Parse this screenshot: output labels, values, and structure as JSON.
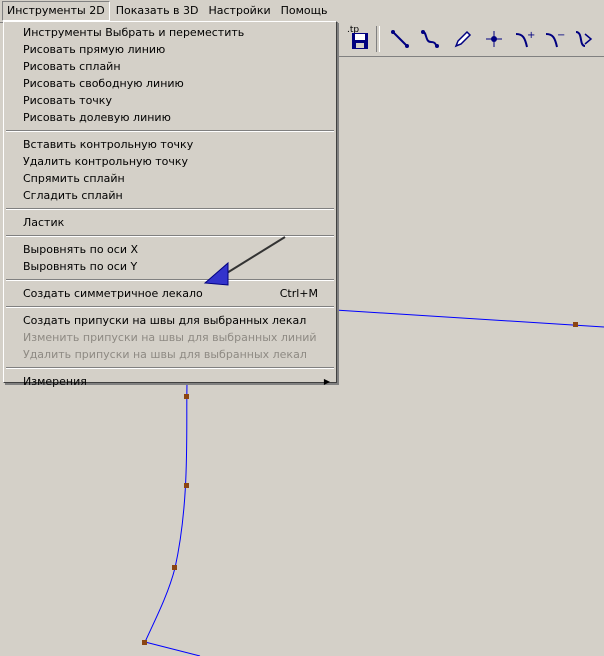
{
  "menubar": {
    "items": [
      {
        "label": "Инструменты 2D"
      },
      {
        "label": "Показать в 3D"
      },
      {
        "label": "Настройки"
      },
      {
        "label": "Помощь"
      }
    ]
  },
  "toolbar": {
    "partial_label": ".tp"
  },
  "menu": {
    "group1": [
      {
        "label": "Инструменты Выбрать и переместить"
      },
      {
        "label": "Рисовать прямую линию"
      },
      {
        "label": "Рисовать сплайн"
      },
      {
        "label": "Рисовать свободную линию"
      },
      {
        "label": "Рисовать точку"
      },
      {
        "label": "Рисовать долевую линию"
      }
    ],
    "group2": [
      {
        "label": "Вставить контрольную точку"
      },
      {
        "label": "Удалить контрольную точку"
      },
      {
        "label": "Спрямить сплайн"
      },
      {
        "label": "Сгладить сплайн"
      }
    ],
    "group3": [
      {
        "label": "Ластик"
      }
    ],
    "group4": [
      {
        "label": "Выровнять по оси X"
      },
      {
        "label": "Выровнять по оси Y"
      }
    ],
    "group5": [
      {
        "label": "Создать симметричное лекало",
        "accel": "Ctrl+M"
      }
    ],
    "group6": [
      {
        "label": "Создать припуски на швы для выбранных лекал"
      },
      {
        "label": "Изменить припуски на швы для выбранных линий"
      },
      {
        "label": "Удалить припуски на швы для выбранных лекал"
      }
    ],
    "group7": [
      {
        "label": "Измерения"
      }
    ]
  },
  "colors": {
    "curve": "#0000ff",
    "control_point": "#8b4513",
    "arrow_fill": "#3333cc"
  }
}
